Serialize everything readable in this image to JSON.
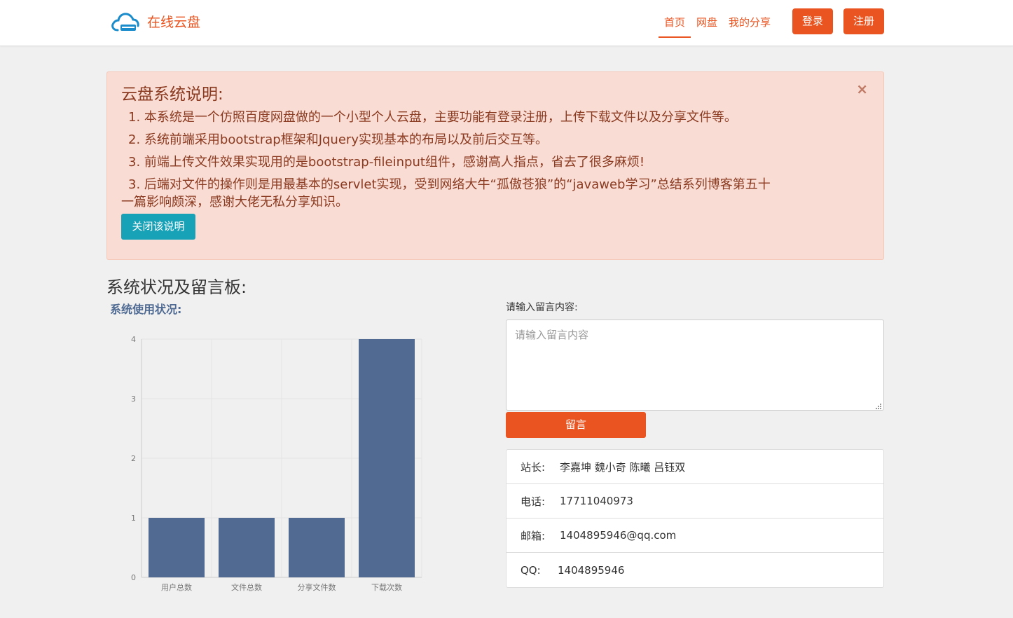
{
  "brand": {
    "name": "在线云盘",
    "logo_icon": "cloud-drive-icon"
  },
  "nav": {
    "links": [
      {
        "label": "首页",
        "active": true
      },
      {
        "label": "网盘",
        "active": false
      },
      {
        "label": "我的分享",
        "active": false
      }
    ],
    "login_label": "登录",
    "register_label": "注册"
  },
  "notice": {
    "title": "云盘系统说明:",
    "close_symbol": "×",
    "lines": [
      "1. 本系统是一个仿照百度网盘做的一个小型个人云盘，主要功能有登录注册，上传下载文件以及分享文件等。",
      "2. 系统前端采用bootstrap框架和Jquery实现基本的布局以及前后交互等。",
      "3. 前端上传文件效果实现用的是bootstrap-fileinput组件，感谢高人指点，省去了很多麻烦!",
      "3. 后端对文件的操作则是用最基本的servlet实现，受到网络大牛“孤傲苍狼”的“javaweb学习”总结系列博客第五十",
      "一篇影响颇深，感谢大佬无私分享知识。"
    ],
    "close_button_label": "关闭该说明"
  },
  "section": {
    "title": "系统状况及留言板:",
    "chart_title": "系统使用状况:"
  },
  "chart_data": {
    "type": "bar",
    "categories": [
      "用户总数",
      "文件总数",
      "分享文件数",
      "下载次数"
    ],
    "values": [
      1,
      1,
      1,
      4
    ],
    "ylim": [
      0,
      4
    ],
    "yticks": [
      0,
      1,
      2,
      3,
      4
    ],
    "bar_color": "#506a91",
    "grid": true
  },
  "message": {
    "label": "请输入留言内容:",
    "placeholder": "请输入留言内容",
    "submit_label": "留言"
  },
  "contact": [
    {
      "key": "站长:",
      "value": "李嘉坤 魏小奇 陈曦 吕钰双"
    },
    {
      "key": "电话:",
      "value": "17711040973"
    },
    {
      "key": "邮箱:",
      "value": "1404895946@qq.com"
    },
    {
      "key": "QQ:",
      "value": "1404895946"
    }
  ],
  "colors": {
    "accent": "#e95420",
    "info": "#17a2b8",
    "alert_bg": "#f9dcd3"
  }
}
